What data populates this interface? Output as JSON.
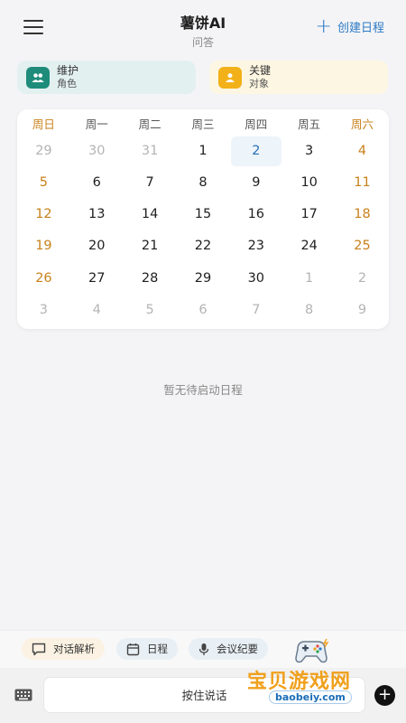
{
  "header": {
    "title": "薯饼AI",
    "subtitle": "问答",
    "create_label": "创建日程"
  },
  "cards": [
    {
      "line1": "维护",
      "line2": "角色",
      "icon": "people-icon"
    },
    {
      "line1": "关键",
      "line2": "对象",
      "icon": "person-icon"
    }
  ],
  "calendar": {
    "weekdays": [
      "周日",
      "周一",
      "周二",
      "周三",
      "周四",
      "周五",
      "周六"
    ],
    "selected_day": "2",
    "weeks": [
      [
        "29",
        "30",
        "31",
        "1",
        "2",
        "3",
        "4"
      ],
      [
        "5",
        "6",
        "7",
        "8",
        "9",
        "10",
        "11"
      ],
      [
        "12",
        "13",
        "14",
        "15",
        "16",
        "17",
        "18"
      ],
      [
        "19",
        "20",
        "21",
        "22",
        "23",
        "24",
        "25"
      ],
      [
        "26",
        "27",
        "28",
        "29",
        "30",
        "1",
        "2"
      ],
      [
        "3",
        "4",
        "5",
        "6",
        "7",
        "8",
        "9"
      ]
    ]
  },
  "empty_text": "暂无待启动日程",
  "quick_actions": [
    {
      "label": "对话解析",
      "icon": "chat-bubble-icon"
    },
    {
      "label": "日程",
      "icon": "calendar-icon"
    },
    {
      "label": "会议纪要",
      "icon": "microphone-icon"
    }
  ],
  "bottom": {
    "talk_label": "按住说话",
    "keyboard_icon": "keyboard-icon",
    "add_icon": "plus-icon"
  },
  "watermark": {
    "text": "宝贝游戏网",
    "url": "baobeiy.com"
  },
  "colors": {
    "accent": "#2d7ac6",
    "weekend": "#c8811a",
    "teal": "#1e8c7a",
    "amber": "#f2b118"
  }
}
